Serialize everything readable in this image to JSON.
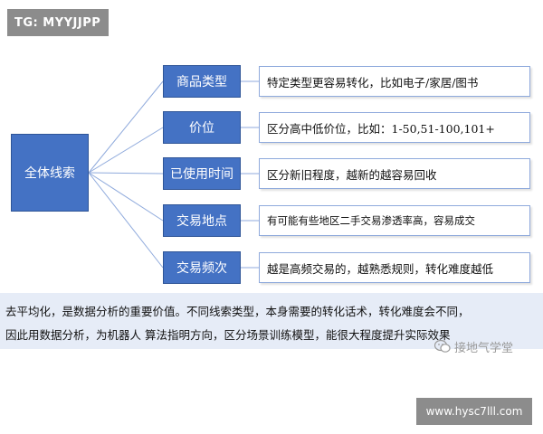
{
  "tag": "TG: MYYJJPP",
  "root": "全体线索",
  "rows": [
    {
      "label": "商品类型",
      "desc": "特定类型更容易转化，比如电子/家居/图书"
    },
    {
      "label": "价位",
      "desc": "区分高中低价位，比如：1-50,51-100,101+"
    },
    {
      "label": "已使用时间",
      "desc": "区分新旧程度，越新的越容易回收"
    },
    {
      "label": "交易地点",
      "desc": "有可能有些地区二手交易渗透率高，容易成交"
    },
    {
      "label": "交易频次",
      "desc": "越是高频交易的，越熟悉规则，转化难度越低"
    }
  ],
  "caption": {
    "line1": "去平均化，是数据分析的重要价值。不同线索类型，本身需要的转化话术，转化难度会不同，",
    "line2": "因此用数据分析，为机器人 算法指明方向，区分场景训练模型，能很大程度提升实际效果"
  },
  "watermark": "接地气学堂",
  "url": "www.hysc7lll.com",
  "colors": {
    "node_fill": "#4472c4",
    "node_border": "#2f5597",
    "desc_border": "#8faadc",
    "connector": "#8faadc",
    "caption_bg": "#e6ecf7",
    "badge_bg": "#8c8c8c"
  }
}
